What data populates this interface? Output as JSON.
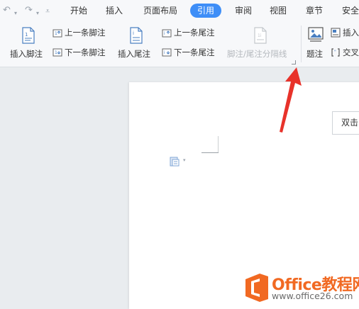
{
  "quick_access": {
    "undo_icon": "undo-icon",
    "redo_icon": "redo-icon",
    "customize_icon": "customize-icon"
  },
  "menu": {
    "tabs": [
      {
        "label": "开始"
      },
      {
        "label": "插入"
      },
      {
        "label": "页面布局"
      },
      {
        "label": "引用",
        "active": true
      },
      {
        "label": "审阅"
      },
      {
        "label": "视图"
      },
      {
        "label": "章节"
      },
      {
        "label": "安全"
      }
    ]
  },
  "ribbon": {
    "insert_footnote": "插入脚注",
    "prev_footnote": "上一条脚注",
    "next_footnote": "下一条脚注",
    "insert_endnote": "插入尾注",
    "prev_endnote": "上一条尾注",
    "next_endnote": "下一条尾注",
    "separator_line": "脚注/尾注分隔线",
    "caption": "题注",
    "insert_partial": "插入",
    "crossref_partial": "交叉"
  },
  "document": {
    "tooltip_partial": "双击"
  },
  "watermark": {
    "title": "Office教程网",
    "url": "www.office26.com"
  },
  "colors": {
    "accent": "#3e8ef7",
    "arrow": "#e8322a",
    "watermark_orange": "#f16922"
  }
}
